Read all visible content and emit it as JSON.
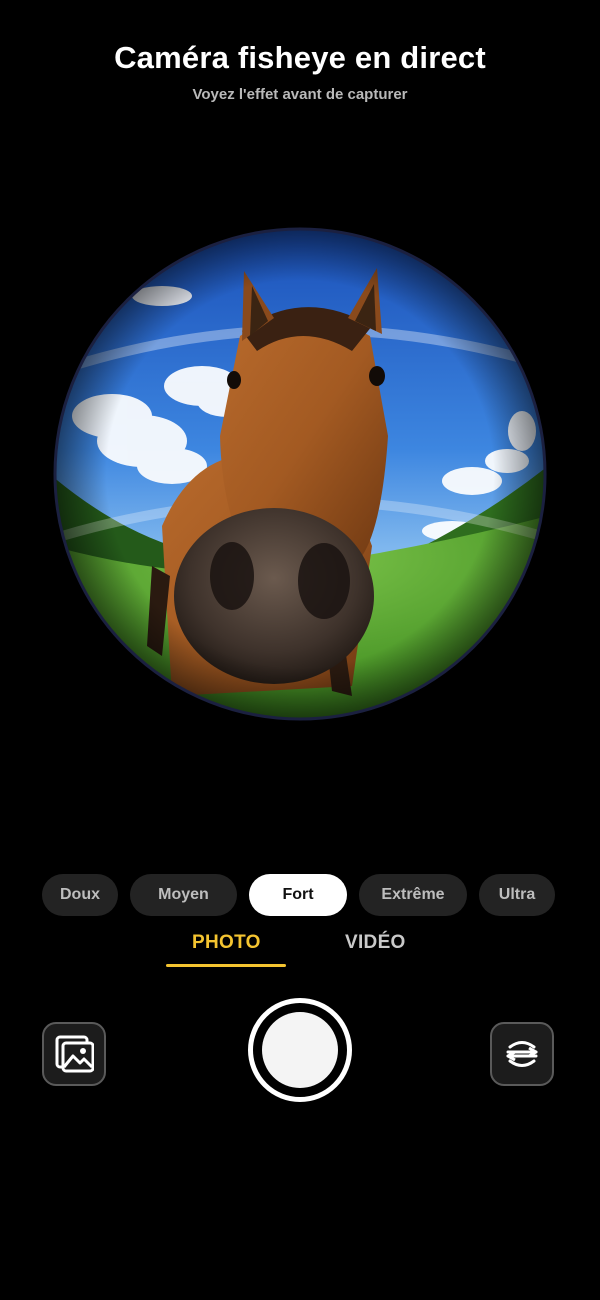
{
  "header": {
    "title": "Caméra fisheye en direct",
    "subtitle": "Voyez l'effet avant de capturer"
  },
  "viewfinder": {
    "content": "horse-fisheye-preview"
  },
  "intensity": {
    "options": [
      "Doux",
      "Moyen",
      "Fort",
      "Extrême",
      "Ultra"
    ],
    "selected": "Fort"
  },
  "modes": {
    "photo": "PHOTO",
    "video": "VIDÉO",
    "selected": "PHOTO"
  },
  "controls": {
    "gallery_icon": "gallery-icon",
    "shutter_icon": "shutter-icon",
    "flip_icon": "flip-camera-icon"
  },
  "colors": {
    "accent": "#f4c430",
    "background": "#000000",
    "pill": "#232323",
    "pill_active": "#ffffff"
  }
}
